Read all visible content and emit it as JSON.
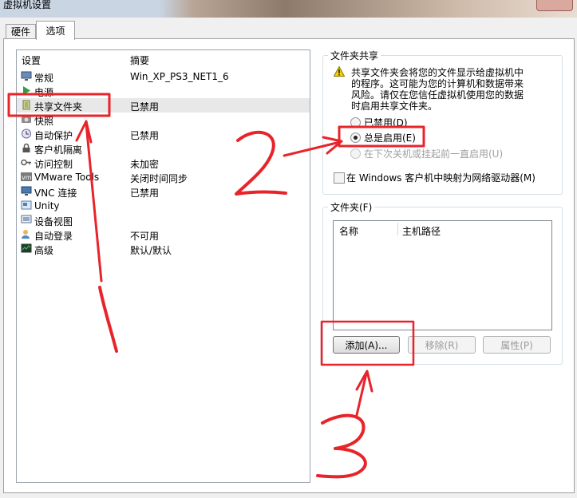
{
  "window": {
    "title": "虚拟机设置"
  },
  "tabs": [
    {
      "label": "硬件"
    },
    {
      "label": "选项"
    }
  ],
  "settings_list": {
    "columns": {
      "setting": "设置",
      "summary": "摘要"
    },
    "items": [
      {
        "name": "常规",
        "summary": "Win_XP_PS3_NET1_6",
        "icon": "monitor-icon"
      },
      {
        "name": "电源",
        "summary": "",
        "icon": "power-play-icon"
      },
      {
        "name": "共享文件夹",
        "summary": "已禁用",
        "icon": "shared-folder-icon"
      },
      {
        "name": "快照",
        "summary": "",
        "icon": "snapshot-icon"
      },
      {
        "name": "自动保护",
        "summary": "已禁用",
        "icon": "clock-icon"
      },
      {
        "name": "客户机隔离",
        "summary": "",
        "icon": "lock-icon"
      },
      {
        "name": "访问控制",
        "summary": "未加密",
        "icon": "key-icon"
      },
      {
        "name": "VMware Tools",
        "summary": "关闭时间同步",
        "icon": "vm-icon"
      },
      {
        "name": "VNC 连接",
        "summary": "已禁用",
        "icon": "vnc-icon"
      },
      {
        "name": "Unity",
        "summary": "",
        "icon": "unity-icon"
      },
      {
        "name": "设备视图",
        "summary": "",
        "icon": "device-view-icon"
      },
      {
        "name": "自动登录",
        "summary": "不可用",
        "icon": "user-icon"
      },
      {
        "name": "高级",
        "summary": "默认/默认",
        "icon": "chart-icon"
      }
    ]
  },
  "folder_sharing": {
    "legend": "文件夹共享",
    "warning_lines": [
      "共享文件夹会将您的文件显示给虚拟机中",
      "的程序。这可能为您的计算机和数据带来",
      "风险。请仅在您信任虚拟机使用您的数据",
      "时启用共享文件夹。"
    ],
    "options": [
      {
        "label": "已禁用(D)",
        "selected": false,
        "enabled": true
      },
      {
        "label": "总是启用(E)",
        "selected": true,
        "enabled": true
      },
      {
        "label": "在下次关机或挂起前一直启用(U)",
        "selected": false,
        "enabled": false
      }
    ],
    "map_drive_label": "在 Windows 客户机中映射为网络驱动器(M)",
    "map_drive_checked": false
  },
  "folders": {
    "legend": "文件夹(F)",
    "columns": {
      "name": "名称",
      "host_path": "主机路径"
    },
    "buttons": {
      "add": "添加(A)...",
      "remove": "移除(R)",
      "properties": "属性(P)"
    }
  },
  "annotations": {
    "step1": "1",
    "step2": "2",
    "step3": "3"
  },
  "colors": {
    "annotation_red": "#e8242b",
    "selection": "#e8e8e8"
  }
}
